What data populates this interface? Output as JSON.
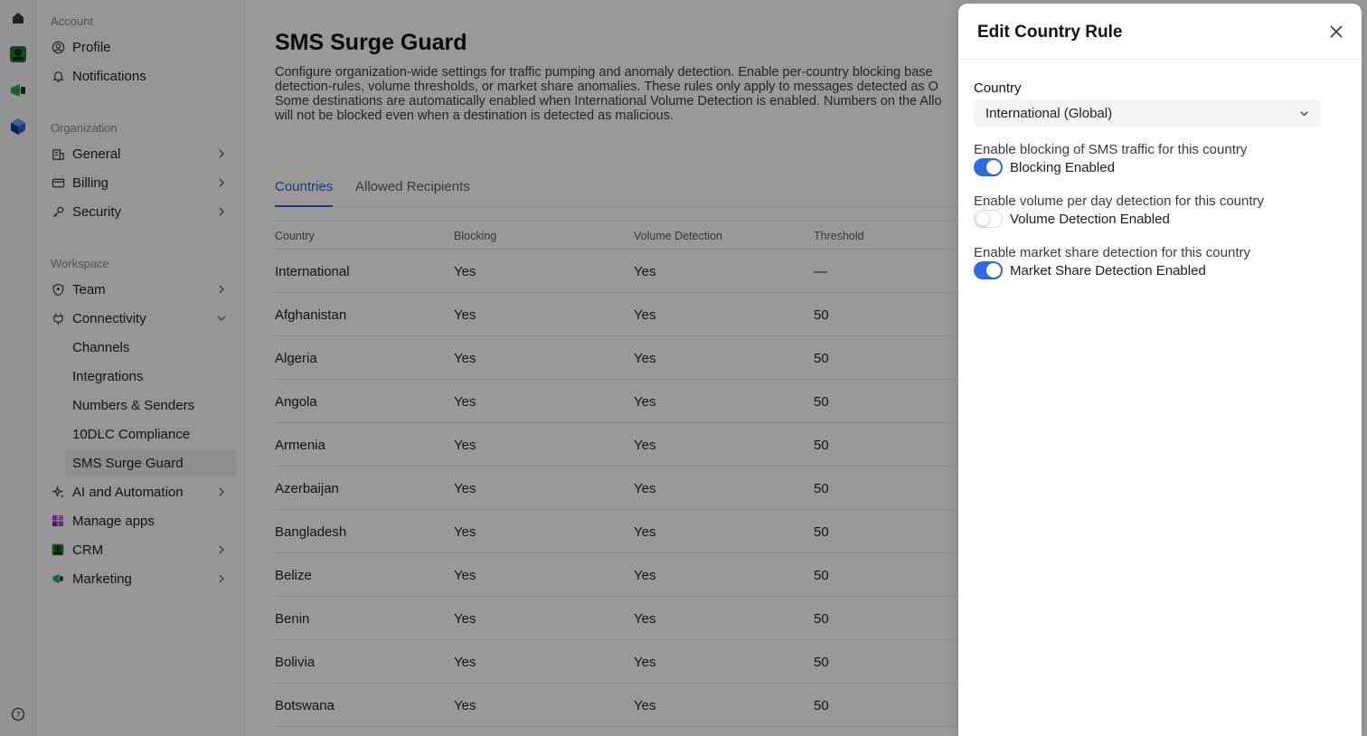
{
  "sidebar": {
    "account_title": "Account",
    "account_items": [
      "Profile",
      "Notifications"
    ],
    "org_title": "Organization",
    "org_items": [
      "General",
      "Billing",
      "Security"
    ],
    "workspace_title": "Workspace",
    "team": "Team",
    "connectivity": "Connectivity",
    "connectivity_sub": [
      "Channels",
      "Integrations",
      "Numbers & Senders",
      "10DLC Compliance",
      "SMS Surge Guard"
    ],
    "ai": "AI and Automation",
    "manage_apps": "Manage apps",
    "crm": "CRM",
    "marketing": "Marketing"
  },
  "main": {
    "title": "SMS Surge Guard",
    "description": "Configure organization-wide settings for traffic pumping and anomaly detection. Enable per-country blocking based on detection-rules, volume thresholds, or market share anomalies. These rules only apply to messages detected as O... Some destinations are automatically enabled when International Volume Detection is enabled. Numbers on the Allo... will not be blocked even when a destination is detected as malicious.",
    "desc_lines": [
      "Configure organization-wide settings for traffic pumping and anomaly detection. Enable per-country blocking base",
      "detection-rules, volume thresholds, or market share anomalies. These rules only apply to messages detected as O",
      "Some destinations are automatically enabled when International Volume Detection is enabled. Numbers on the Allo",
      "will not be blocked even when a destination is detected as malicious."
    ],
    "tabs": [
      "Countries",
      "Allowed Recipients"
    ],
    "columns": [
      "Country",
      "Blocking",
      "Volume Detection",
      "Threshold"
    ],
    "rows": [
      [
        "International",
        "Yes",
        "Yes",
        "—"
      ],
      [
        "Afghanistan",
        "Yes",
        "Yes",
        "50"
      ],
      [
        "Algeria",
        "Yes",
        "Yes",
        "50"
      ],
      [
        "Angola",
        "Yes",
        "Yes",
        "50"
      ],
      [
        "Armenia",
        "Yes",
        "Yes",
        "50"
      ],
      [
        "Azerbaijan",
        "Yes",
        "Yes",
        "50"
      ],
      [
        "Bangladesh",
        "Yes",
        "Yes",
        "50"
      ],
      [
        "Belize",
        "Yes",
        "Yes",
        "50"
      ],
      [
        "Benin",
        "Yes",
        "Yes",
        "50"
      ],
      [
        "Bolivia",
        "Yes",
        "Yes",
        "50"
      ],
      [
        "Botswana",
        "Yes",
        "Yes",
        "50"
      ]
    ]
  },
  "drawer": {
    "title": "Edit Country Rule",
    "country_label": "Country",
    "country_value": "International (Global)",
    "options": [
      {
        "desc": "Enable blocking of SMS traffic for this country",
        "label": "Blocking Enabled",
        "on": true
      },
      {
        "desc": "Enable volume per day detection for this country",
        "label": "Volume Detection Enabled",
        "on": false
      },
      {
        "desc": "Enable market share detection for this country",
        "label": "Market Share Detection Enabled",
        "on": true
      }
    ]
  },
  "colors": {
    "accent": "#2f6ae0",
    "tab_active": "#2f5bd3",
    "overlay": "rgba(0,0,0,0.4)"
  },
  "icons": [
    "home-icon",
    "crm-app-icon",
    "marketing-app-icon",
    "cube-app-icon",
    "help-icon",
    "profile-icon",
    "bell-icon",
    "building-icon",
    "card-icon",
    "key-icon",
    "shield-icon",
    "plug-icon",
    "sparkle-icon",
    "apps-icon",
    "close-icon",
    "chevron-down-icon"
  ]
}
